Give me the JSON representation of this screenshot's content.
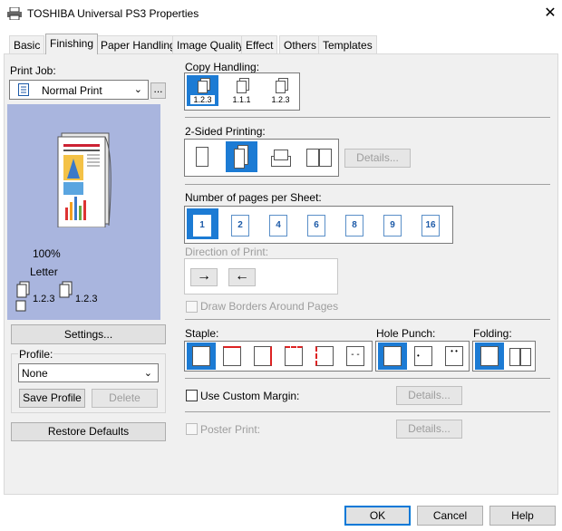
{
  "window": {
    "title": "TOSHIBA Universal PS3 Properties"
  },
  "tabs": [
    {
      "label": "Basic"
    },
    {
      "label": "Finishing"
    },
    {
      "label": "Paper Handling"
    },
    {
      "label": "Image Quality"
    },
    {
      "label": "Effect"
    },
    {
      "label": "Others"
    },
    {
      "label": "Templates"
    }
  ],
  "active_tab": "Finishing",
  "left": {
    "print_job_label": "Print Job:",
    "print_job_value": "Normal Print",
    "more_button": "...",
    "preview": {
      "zoom": "100%",
      "paper": "Letter",
      "collate1": "1.2.3",
      "collate2": "1.2.3"
    },
    "settings_button": "Settings...",
    "profile_label": "Profile:",
    "profile_value": "None",
    "save_profile_button": "Save Profile",
    "delete_button": "Delete",
    "restore_defaults_button": "Restore Defaults"
  },
  "copy_handling": {
    "label": "Copy Handling:",
    "options": [
      "1.2.3",
      "1.1.1",
      "1.2.3"
    ],
    "selected": 0
  },
  "two_sided": {
    "label": "2-Sided Printing:",
    "details_button": "Details..."
  },
  "pages_per_sheet": {
    "label": "Number of pages per Sheet:",
    "options": [
      "1",
      "2",
      "4",
      "6",
      "8",
      "9",
      "16"
    ],
    "selected": 0
  },
  "direction": {
    "label": "Direction of Print:",
    "right_arrow": "→",
    "left_arrow": "←"
  },
  "draw_borders": {
    "label": "Draw Borders Around Pages",
    "checked": false
  },
  "staple": {
    "label": "Staple:"
  },
  "hole_punch": {
    "label": "Hole Punch:"
  },
  "folding": {
    "label": "Folding:"
  },
  "custom_margin": {
    "label": "Use Custom Margin:",
    "details_button": "Details..."
  },
  "poster_print": {
    "label": "Poster Print:",
    "details_button": "Details..."
  },
  "footer": {
    "ok": "OK",
    "cancel": "Cancel",
    "help": "Help"
  },
  "colors": {
    "accent": "#1c7bd4",
    "panel": "#f0f0f0",
    "preview_bg": "#a9b5de",
    "disabled_text": "#9d9d9d"
  },
  "icons": [
    "printer-icon",
    "close-icon",
    "chevron-down-icon",
    "arrow-right-icon",
    "arrow-left-icon"
  ]
}
